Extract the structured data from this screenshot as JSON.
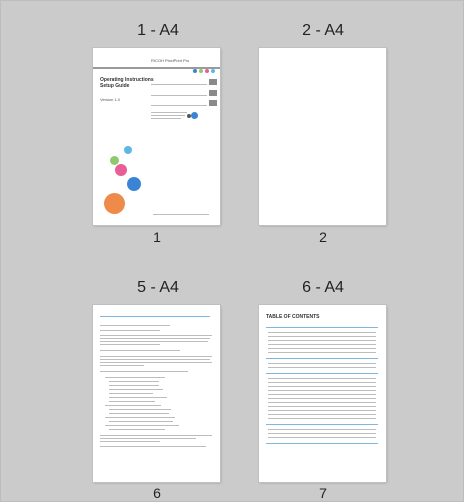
{
  "pages": [
    {
      "title": "1 - A4",
      "number": "1"
    },
    {
      "title": "2 - A4",
      "number": "2"
    },
    {
      "title": "5 - A4",
      "number": "6"
    },
    {
      "title": "6 - A4",
      "number": "7"
    }
  ],
  "page1": {
    "header": "RICOH PixelPrint Pro",
    "heading_line1": "Operating Instructions",
    "heading_line2": "Setup Guide",
    "version": "Version 1.0"
  },
  "page6": {
    "toc_title": "TABLE OF CONTENTS"
  },
  "colors": {
    "dot1": "#5cb8e6",
    "dot2": "#8fc96d",
    "dot3": "#e75f96",
    "dot4": "#3a84d5",
    "dot5": "#ee8a4a",
    "accent": "#7fb7df"
  }
}
